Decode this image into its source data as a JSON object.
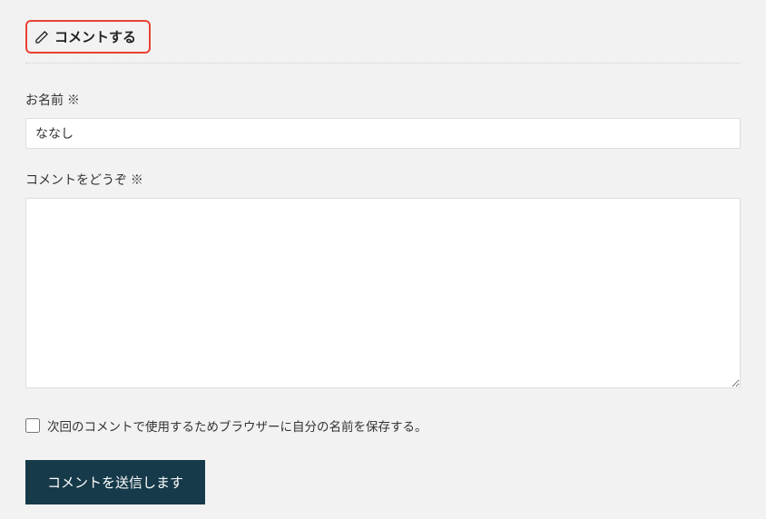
{
  "form": {
    "heading": "コメントする",
    "name_label": "お名前 ※",
    "name_value": "ななし",
    "comment_label": "コメントをどうぞ ※",
    "comment_value": "",
    "save_checkbox_label": "次回のコメントで使用するためブラウザーに自分の名前を保存する。",
    "submit_label": "コメントを送信します"
  },
  "icons": {
    "pencil": "pencil-icon"
  }
}
